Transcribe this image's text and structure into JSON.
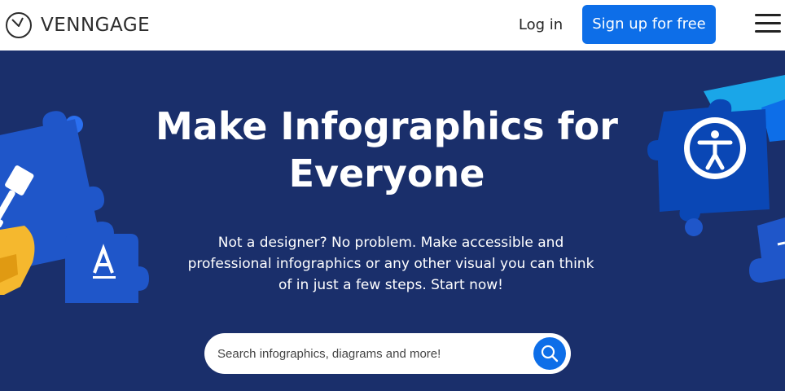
{
  "header": {
    "logo_text": "VENNGAGE",
    "login_label": "Log in",
    "signup_label": "Sign up for free"
  },
  "hero": {
    "title": "Make Infographics for Everyone",
    "subtitle": "Not a designer? No problem. Make accessible and professional infographics or any other visual you can think of in just a few steps. Start now!"
  },
  "search": {
    "placeholder": "Search infographics, diagrams and more!"
  },
  "icons": {
    "logo": "venngage-logo-icon",
    "menu": "hamburger-menu-icon",
    "search": "search-icon",
    "paintbrush": "paintbrush-icon",
    "font": "font-icon",
    "accessibility": "accessibility-icon"
  },
  "colors": {
    "brand_blue": "#0d6ee8",
    "hero_bg": "#1a2f6b",
    "puzzle_blue": "#1f56c9",
    "puzzle_dark": "#0a47b5",
    "accent_yellow": "#f5b82e",
    "accent_cyan": "#1aa6e8"
  }
}
